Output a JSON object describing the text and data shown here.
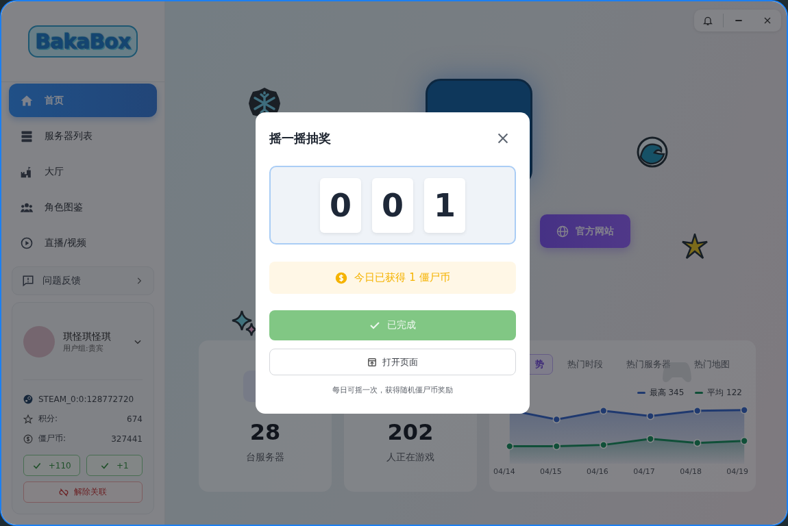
{
  "sidebar": {
    "logo": "BakaBox",
    "nav": [
      {
        "label": "首页",
        "selected": true
      },
      {
        "label": "服务器列表",
        "selected": false
      },
      {
        "label": "大厅",
        "selected": false
      },
      {
        "label": "角色图鉴",
        "selected": false
      },
      {
        "label": "直播/视频",
        "selected": false
      }
    ],
    "feedback": "问题反馈",
    "user": {
      "name": "琪怪琪怪琪",
      "group": "用户组:贵宾",
      "steam_id": "STEAM_0:0:128772720",
      "stats": [
        {
          "label": "积分:",
          "value": "674"
        },
        {
          "label": "僵尸币:",
          "value": "327441"
        }
      ],
      "claim_buttons": [
        "+110",
        "+1"
      ],
      "unlink": "解除关联"
    }
  },
  "hero": {
    "website_button": "官方网站"
  },
  "stats": [
    {
      "value": "28",
      "label": "台服务器"
    },
    {
      "value": "202",
      "label": "人正在游戏"
    }
  ],
  "trend_card": {
    "tabs": [
      {
        "label": "势",
        "selected": true
      },
      {
        "label": "热门时段",
        "selected": false
      },
      {
        "label": "热门服务器",
        "selected": false
      },
      {
        "label": "热门地图",
        "selected": false
      }
    ],
    "legend": [
      {
        "label": "最高 345"
      },
      {
        "label": "平均 122"
      }
    ],
    "x_labels": [
      "04/14",
      "04/15",
      "04/16",
      "04/17",
      "04/18",
      "04/19"
    ]
  },
  "dialog": {
    "title": "摇一摇抽奖",
    "digits": [
      "0",
      "0",
      "1"
    ],
    "reward": "今日已获得 1 僵尸币",
    "done_button": {
      "label": "已完成",
      "disabled": true
    },
    "open_button": "打开页面",
    "note": "每日可摇一次，获得随机僵尸币奖励"
  }
}
